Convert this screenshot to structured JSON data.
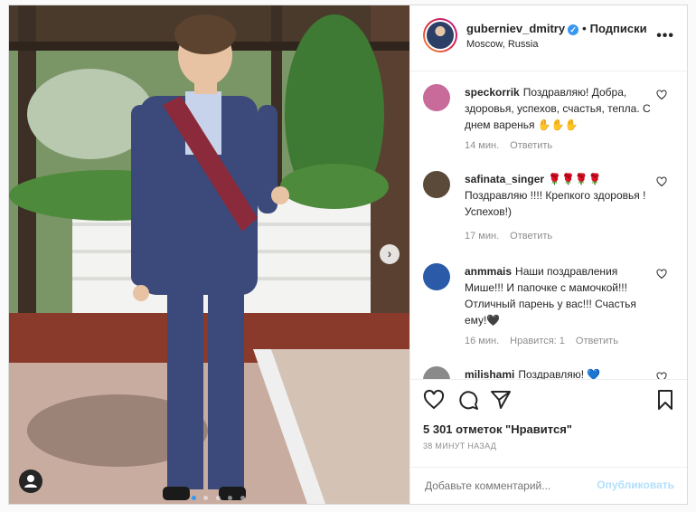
{
  "header": {
    "username": "guberniev_dmitry",
    "separator": "•",
    "follow_label": "Подписки",
    "location": "Moscow, Russia",
    "verified_icon": "verified-badge-icon",
    "more_icon": "more-options-icon"
  },
  "comments": [
    {
      "username": "speckorrik",
      "text": "Поздравляю! Добра, здоровья, успехов, счастья, тепла. С днем варенья ✋✋✋",
      "time": "14 мин.",
      "reply": "Ответить",
      "likes": "",
      "avatar_color": "#c86a9a"
    },
    {
      "username": "safinata_singer",
      "text": "🌹🌹🌹🌹 Поздравляю !!!! Крепкого здоровья ! Успехов!)",
      "time": "17 мин.",
      "reply": "Ответить",
      "likes": "",
      "avatar_color": "#5b4a3a"
    },
    {
      "username": "anmmais",
      "text": "Наши поздравления Мише!!! И папочке с мамочкой!!! Отличный парень у вас!!! Счастья ему!🖤",
      "time": "16 мин.",
      "likes": "Нравится: 1",
      "reply": "Ответить",
      "avatar_color": "#2b5aa8"
    },
    {
      "username": "milishami",
      "text": "Поздравляю! 💙",
      "time": "",
      "reply": "",
      "likes": "",
      "avatar_color": "#8a8a8a"
    }
  ],
  "actions": {
    "like_icon": "heart-icon",
    "comment_icon": "comment-icon",
    "share_icon": "share-icon",
    "save_icon": "bookmark-icon",
    "likes_text": "5 301 отметок \"Нравится\"",
    "time_ago": "38 МИНУТ НАЗАД"
  },
  "add_comment": {
    "placeholder": "Добавьте комментарий...",
    "publish_label": "Опубликовать"
  },
  "carousel": {
    "next_icon": "chevron-right-icon",
    "user_tag_icon": "user-tag-icon",
    "slide_count": 5,
    "active_slide": 1
  },
  "colors": {
    "accent": "#3897f0",
    "publish_disabled": "#b2dffc",
    "secondary_text": "#8e8e8e",
    "border": "#dbdbdb"
  }
}
